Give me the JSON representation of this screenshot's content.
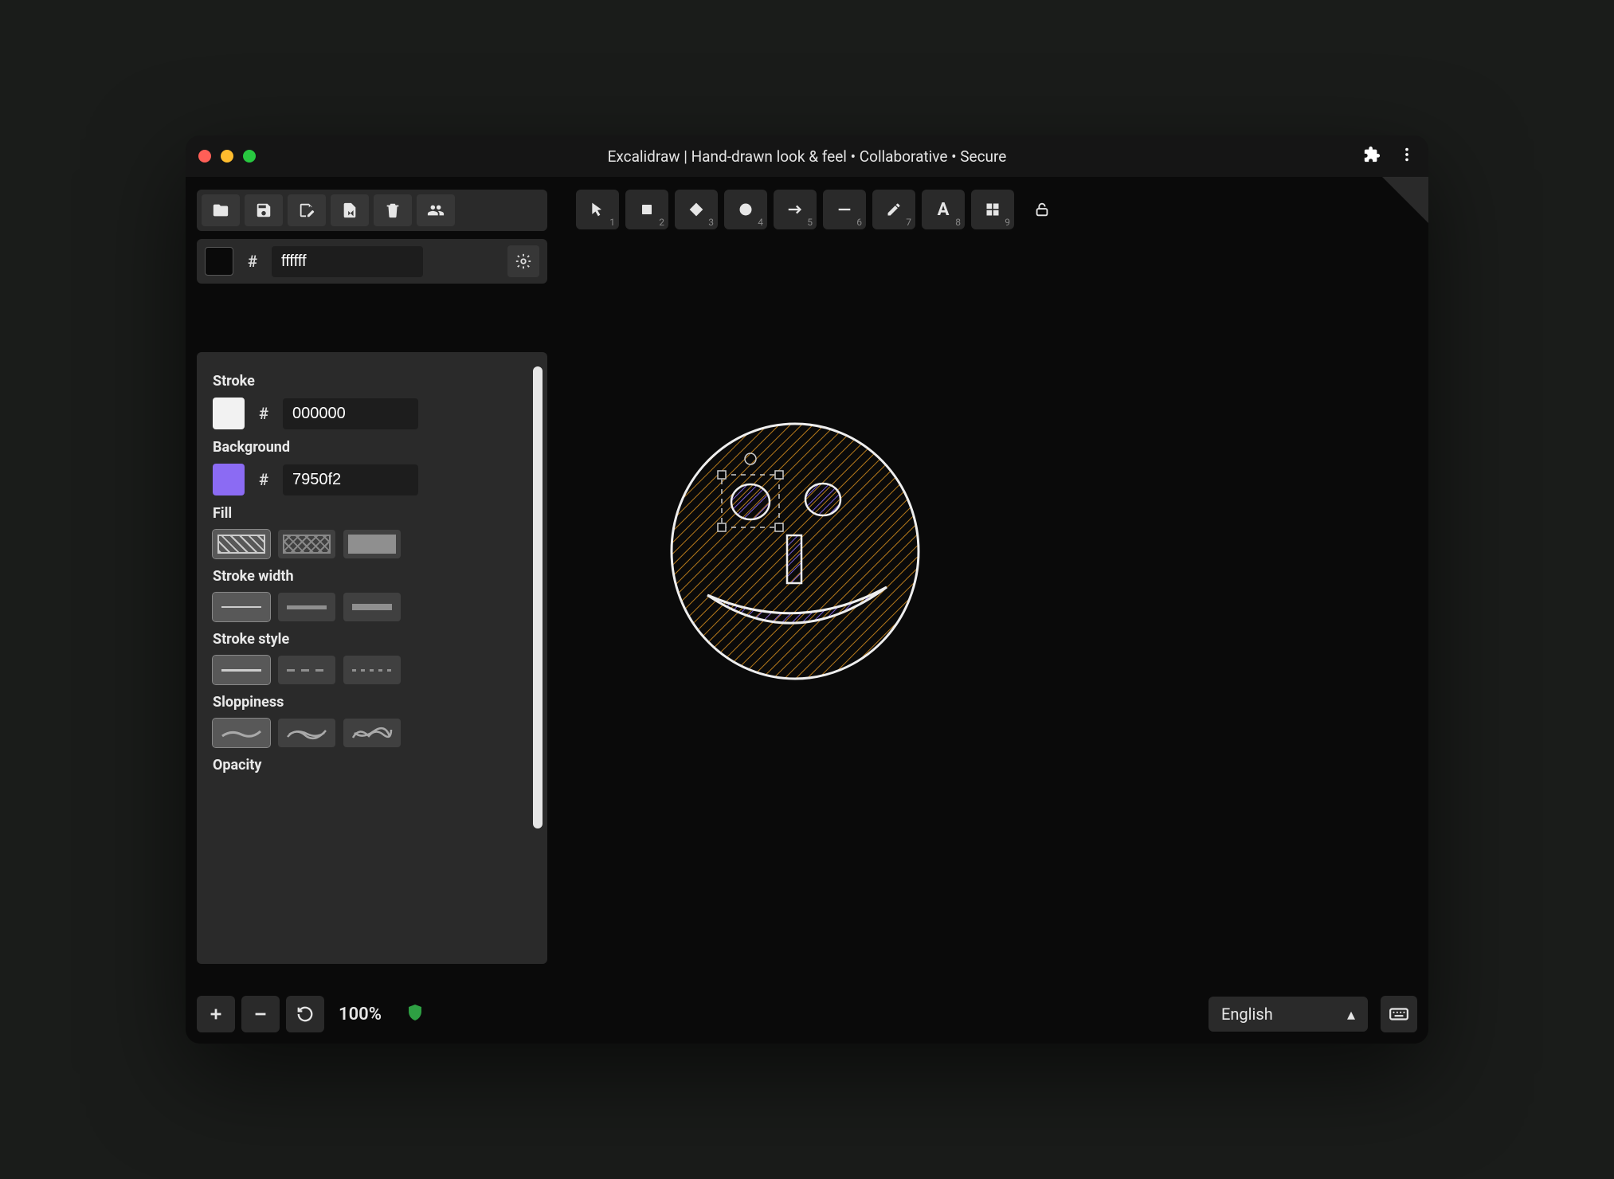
{
  "window": {
    "title": "Excalidraw | Hand-drawn look & feel • Collaborative • Secure"
  },
  "menu": {
    "items": [
      "open",
      "save",
      "export-image",
      "export",
      "delete",
      "collaborate"
    ]
  },
  "canvasColor": {
    "hash": "#",
    "hex": "ffffff"
  },
  "panel": {
    "stroke": {
      "label": "Stroke",
      "hash": "#",
      "hex": "000000",
      "color": "#f2f2f2"
    },
    "background": {
      "label": "Background",
      "hash": "#",
      "hex": "7950f2",
      "color": "#8b6bf3"
    },
    "fill": {
      "label": "Fill",
      "selected": 0
    },
    "strokeWidth": {
      "label": "Stroke width",
      "selected": 0
    },
    "strokeStyle": {
      "label": "Stroke style",
      "selected": 0
    },
    "sloppiness": {
      "label": "Sloppiness",
      "selected": 0
    },
    "opacity": {
      "label": "Opacity"
    }
  },
  "tools": {
    "items": [
      {
        "name": "selection",
        "num": "1"
      },
      {
        "name": "rectangle",
        "num": "2"
      },
      {
        "name": "diamond",
        "num": "3"
      },
      {
        "name": "ellipse",
        "num": "4"
      },
      {
        "name": "arrow",
        "num": "5"
      },
      {
        "name": "line",
        "num": "6"
      },
      {
        "name": "draw",
        "num": "7"
      },
      {
        "name": "text",
        "num": "8"
      },
      {
        "name": "library",
        "num": "9"
      }
    ]
  },
  "zoom": {
    "value": "100%"
  },
  "language": {
    "value": "English"
  }
}
